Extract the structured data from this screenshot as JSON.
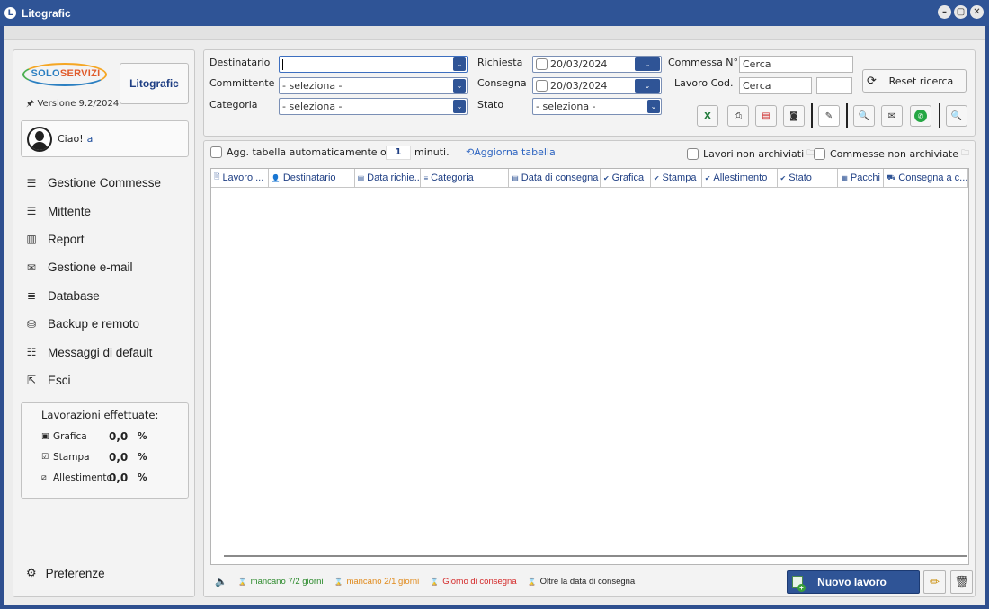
{
  "window": {
    "title": "Litografic",
    "app_icon": "L",
    "min": "–",
    "max": "▢",
    "close": "✕"
  },
  "sidebar": {
    "logo_part1": "SOLO",
    "logo_part2": "SERVIZI",
    "version": "Versione 9.2/2024",
    "app_button": "Litografic",
    "greeting": "Ciao!",
    "user": "a",
    "menu": [
      {
        "label": "Gestione Commesse",
        "icon": "☰"
      },
      {
        "label": "Mittente",
        "icon": "☰"
      },
      {
        "label": "Report",
        "icon": "▥"
      },
      {
        "label": "Gestione e-mail",
        "icon": "✉"
      },
      {
        "label": "Database",
        "icon": "≣"
      },
      {
        "label": "Backup e remoto",
        "icon": "⛁"
      },
      {
        "label": "Messaggi di default",
        "icon": "☷"
      },
      {
        "label": "Esci",
        "icon": "⇱"
      }
    ],
    "stats": {
      "title": "Lavorazioni effettuate:",
      "rows": [
        {
          "label": "Grafica",
          "value": "0,0",
          "unit": "%"
        },
        {
          "label": "Stampa",
          "value": "0,0",
          "unit": "%"
        },
        {
          "label": "Allestimento",
          "value": "0,0",
          "unit": "%"
        }
      ]
    },
    "prefs": "Preferenze"
  },
  "filters": {
    "destinatario": {
      "label": "Destinatario",
      "value": ""
    },
    "committente": {
      "label": "Committente",
      "value": "- seleziona -"
    },
    "categoria": {
      "label": "Categoria",
      "value": "- seleziona -"
    },
    "richiesta": {
      "label": "Richiesta",
      "value": "20/03/2024"
    },
    "consegna": {
      "label": "Consegna",
      "value": "20/03/2024"
    },
    "stato": {
      "label": "Stato",
      "value": "- seleziona -"
    },
    "commessa": {
      "label": "Commessa N°",
      "placeholder": "Cerca"
    },
    "lavoro_cod": {
      "label": "Lavoro Cod.",
      "placeholder": "Cerca",
      "value2": ""
    },
    "reset": "Reset ricerca"
  },
  "table_opts": {
    "auto_update": "Agg. tabella automaticamente ogni",
    "minutes": "1",
    "minutes_label": "minuti.",
    "refresh": "Aggiorna tabella",
    "lavori_non_arch": "Lavori non archiviati",
    "commesse_non_arch": "Commesse non archiviate"
  },
  "columns": [
    {
      "label": "Lavoro ...",
      "icon": "🗎",
      "w": 64
    },
    {
      "label": "Destinatario",
      "icon": "👤",
      "w": 96
    },
    {
      "label": "Data richie...",
      "icon": "▤",
      "w": 74
    },
    {
      "label": "Categoria",
      "icon": "≡",
      "w": 98
    },
    {
      "label": "Data di consegna",
      "icon": "▤",
      "w": 102
    },
    {
      "label": "Grafica",
      "icon": "✔",
      "w": 56
    },
    {
      "label": "Stampa",
      "icon": "✔",
      "w": 57
    },
    {
      "label": "Allestimento",
      "icon": "✔",
      "w": 84
    },
    {
      "label": "Stato",
      "icon": "✔",
      "w": 68
    },
    {
      "label": "Pacchi",
      "icon": "▦",
      "w": 51
    },
    {
      "label": "Consegna a c...",
      "icon": "⛟",
      "w": 94
    }
  ],
  "legend": [
    {
      "label": "mancano 7/2 giorni",
      "color": "#2c8a2c"
    },
    {
      "label": "mancano 2/1 giorni",
      "color": "#e08a1c"
    },
    {
      "label": "Giorno di consegna",
      "color": "#d42a2a"
    },
    {
      "label": "Oltre la data di consegna",
      "color": "#222222"
    }
  ],
  "actions": {
    "nuovo": "Nuovo lavoro"
  }
}
